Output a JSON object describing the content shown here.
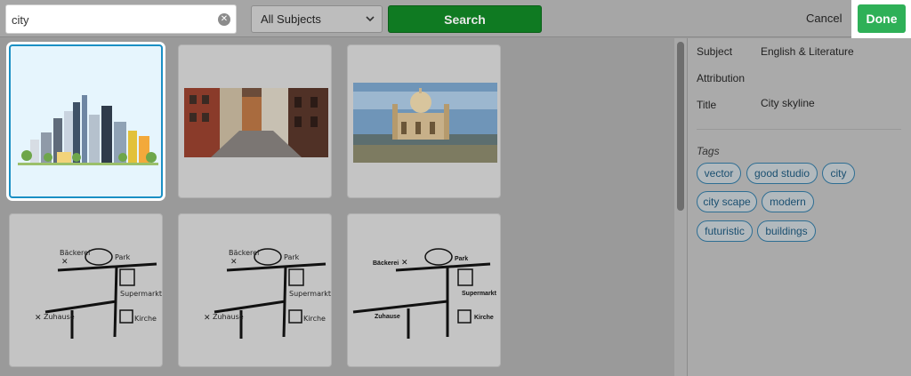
{
  "search": {
    "value": "city",
    "clear_icon": "close-icon"
  },
  "subject_filter": {
    "selected": "All Subjects"
  },
  "buttons": {
    "search": "Search",
    "cancel": "Cancel",
    "done": "Done"
  },
  "colors": {
    "search_button": "#0f7a22",
    "done_button": "#2eb057",
    "selected_border": "#1a8fc4",
    "tag_text": "#1a4f70"
  },
  "grid": {
    "cards": [
      {
        "name": "city skyline illustration",
        "selected": true
      },
      {
        "name": "old town street photo",
        "selected": false
      },
      {
        "name": "mosque in sea photo",
        "selected": false
      },
      {
        "name": "hand-drawn map",
        "selected": false
      },
      {
        "name": "hand-drawn map",
        "selected": false
      },
      {
        "name": "typed map",
        "selected": false
      }
    ],
    "map_labels_handwritten": {
      "bakery": "Bäckerei",
      "park": "Park",
      "supermarket": "Supermarkt",
      "home": "Zuhause",
      "church": "Kirche"
    },
    "map_labels_typed": {
      "bakery": "Bäckerei",
      "park": "Park",
      "supermarket": "Supermarkt",
      "home": "Zuhause",
      "church": "Kirche"
    }
  },
  "details": {
    "subject_label": "Subject",
    "subject_value": "English & Literature",
    "attribution_label": "Attribution",
    "title_label": "Title",
    "title_value": "City skyline",
    "tags_label": "Tags",
    "tags": [
      "vector",
      "good studio",
      "city",
      "city scape",
      "modern",
      "futuristic",
      "buildings"
    ]
  }
}
